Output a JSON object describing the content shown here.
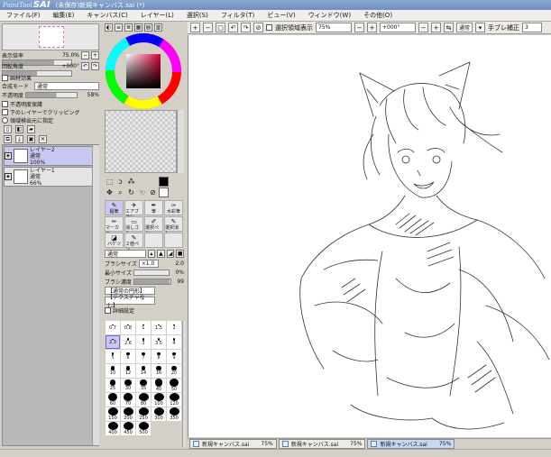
{
  "window": {
    "logo_small": "PaintTool",
    "logo_big": "SAI",
    "title": "(未保存)新規キャンバス.sai (*)"
  },
  "menu": [
    "ファイル(F)",
    "編集(E)",
    "キャンバス(C)",
    "レイヤー(L)",
    "選択(S)",
    "フィルタ(T)",
    "ビュー(V)",
    "ウィンドウ(W)",
    "その他(O)"
  ],
  "navigator": {
    "zoom_label": "表示倍率",
    "zoom_value": "75.0%",
    "rotate_label": "回転角度",
    "rotate_value": "+000°"
  },
  "layer_props": {
    "effect_label": "画材効果",
    "mode_label": "合成モード",
    "mode_value": "通常",
    "opacity_label": "不透明度",
    "opacity_value": "58%",
    "checks": [
      "不透明度保護",
      "下のレイヤーでクリッピング"
    ],
    "radio": "領域検出元に指定"
  },
  "layers": [
    {
      "name": "レイヤー2",
      "mode": "通常",
      "opacity": "100%"
    },
    {
      "name": "レイヤー1",
      "mode": "通常",
      "opacity": "66%"
    }
  ],
  "tools": {
    "tiles": [
      {
        "label": "鉛筆",
        "icon": "✎"
      },
      {
        "label": "エアブラシ",
        "icon": "✈"
      },
      {
        "label": "筆",
        "icon": "✒"
      },
      {
        "label": "水彩筆",
        "icon": "✑"
      },
      {
        "label": "マーカー",
        "icon": "✏"
      },
      {
        "label": "消しゴム",
        "icon": "▭"
      },
      {
        "label": "選択ペン",
        "icon": "✐"
      },
      {
        "label": "選択消し",
        "icon": "✎"
      },
      {
        "label": "バケツ",
        "icon": "◪"
      },
      {
        "label": "２値ペン",
        "icon": "✎"
      },
      {
        "label": "",
        "icon": ""
      },
      {
        "label": "",
        "icon": ""
      }
    ],
    "blend_value": "通常",
    "size_label": "ブラシサイズ",
    "size_mult": "×1.0",
    "size_value": "2.0",
    "min_label": "最小サイズ",
    "min_value": "0%",
    "density_label": "ブラシ濃度",
    "density_value": "99",
    "shape_value": "【通常の円形】",
    "texture_value": "【テクスチャなし】",
    "detail_label": "詳細設定",
    "sizes": [
      "0.7",
      "0.8",
      "1",
      "1.5",
      "2",
      "2.3",
      "2.6",
      "3",
      "3.5",
      "4",
      "5",
      "6",
      "7",
      "8",
      "9",
      "10",
      "12",
      "14",
      "16",
      "20",
      "25",
      "30",
      "35",
      "40",
      "50",
      "60",
      "70",
      "80",
      "100",
      "120",
      "150",
      "200",
      "250",
      "300",
      "350",
      "400",
      "450",
      "500"
    ],
    "selected_size": "2.3"
  },
  "toolbar": {
    "select_label": "選択領域表示",
    "zoom": "75%",
    "rotate": "+000°",
    "blend": "通常",
    "stab_label": "手ブレ補正",
    "stab_value": "3"
  },
  "tabs": [
    {
      "name": "新規キャンバス.sai",
      "zoom": "75%"
    },
    {
      "name": "新規キャンバス.sai",
      "zoom": "75%"
    },
    {
      "name": "新規キャンバス.sai",
      "zoom": "75%"
    }
  ],
  "colors": {
    "accent": "#c9c8f2",
    "selected_layer": "#c9c8f2",
    "active_tab": "#c6d8f4",
    "primary_color": "#000000"
  }
}
